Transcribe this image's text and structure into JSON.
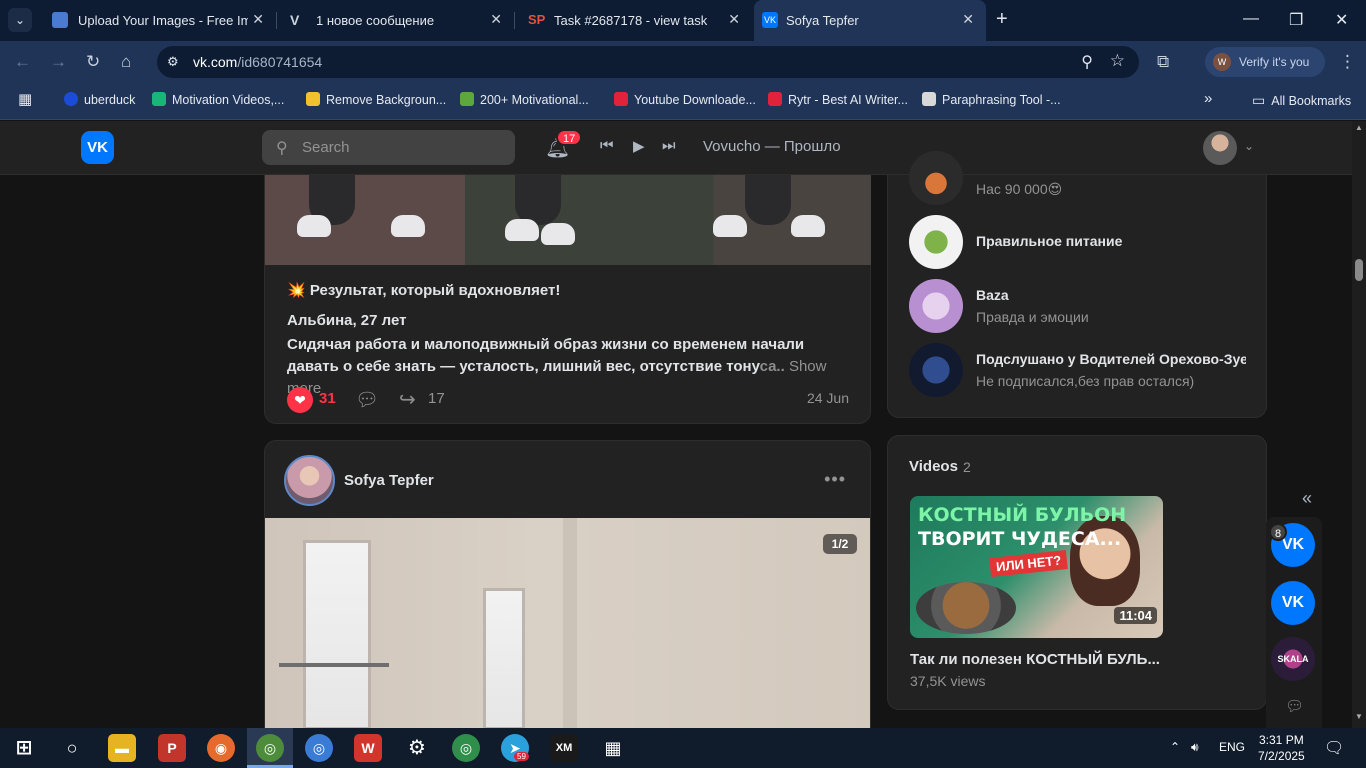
{
  "browser": {
    "tabs": [
      {
        "title": "Upload Your Images - Free Imag",
        "favicon": "image-host-icon",
        "color": "#4a7bd0"
      },
      {
        "title": "1 новое сообщение",
        "favicon": "v-icon",
        "color": "#c9d1de"
      },
      {
        "title": "Task #2687178 - view task",
        "favicon": "sp-icon",
        "color": "#e0533a"
      },
      {
        "title": "Sofya Tepfer",
        "favicon": "vk-icon",
        "color": "#0077ff",
        "active": true
      }
    ],
    "url_host": "vk.com",
    "url_path": "/id680741654",
    "profile_label": "Verify it's you",
    "profile_initial": "W",
    "bookmarks": [
      {
        "label": "uberduck",
        "color": "#1c4bd6"
      },
      {
        "label": "Motivation Videos,...",
        "color": "#1ab57a"
      },
      {
        "label": "Remove Backgroun...",
        "color": "#f2c12e"
      },
      {
        "label": "200+ Motivational...",
        "color": "#5ea83b"
      },
      {
        "label": "Youtube Downloade...",
        "color": "#e0223a"
      },
      {
        "label": "Rytr - Best AI Writer...",
        "color": "#e0223a"
      },
      {
        "label": "Paraphrasing Tool -...",
        "color": "#d8d8d8"
      }
    ],
    "all_bookmarks": "All Bookmarks"
  },
  "vk": {
    "logo": "VK",
    "search_placeholder": "Search",
    "notif_count": "17",
    "now_playing": "Vovucho — Прошло"
  },
  "post1": {
    "headline": "💥 Результат, который вдохновляет!",
    "author_line": "Альбина, 27 лет",
    "body_main": "Сидячая работа и малоподвижный образ жизни со временем начали давать о себе знать — усталость, лишний вес, отсутствие тону",
    "body_faded": "са.. ",
    "show_more": "Show more",
    "likes": "31",
    "shares": "17",
    "date": "24 Jun"
  },
  "post2": {
    "author": "Sofya Tepfer",
    "counter": "1/2"
  },
  "groups": [
    {
      "name": "",
      "sub": "Нас 90 000😍"
    },
    {
      "name": "Правильное питание",
      "sub": ""
    },
    {
      "name": "Baza",
      "sub": "Правда и эмоции"
    },
    {
      "name": "Подслушано у Водителей Орехово-Зуе...",
      "sub": "Не подписался,без прав остался)"
    }
  ],
  "videos": {
    "title": "Videos",
    "count": "2",
    "thumb_line1": "КОСТНЫЙ БУЛЬОН",
    "thumb_line2": "ТВОРИТ ЧУДЕСА...",
    "thumb_tag": "ИЛИ НЕТ?",
    "duration": "11:04",
    "name": "Так ли полезен КОСТНЫЙ БУЛЬ...",
    "views": "37,5K views"
  },
  "dock": {
    "badge": "8",
    "skala": "SKALA"
  },
  "taskbar": {
    "telegram_badge": "59",
    "lang": "ENG",
    "time": "3:31 PM",
    "date": "7/2/2025"
  }
}
